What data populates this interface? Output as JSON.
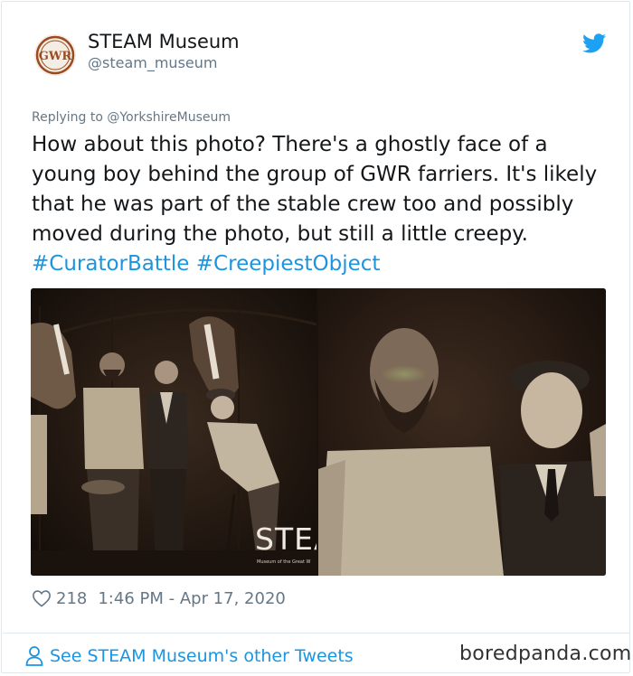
{
  "account": {
    "display_name": "STEAM Museum",
    "handle": "@steam_museum",
    "avatar_text": "GWR",
    "avatar_color": "#9c4a1f"
  },
  "tweet": {
    "reply_to": "Replying to @YorkshireMuseum",
    "text": "How about this photo? There's a ghostly face of a young boy behind the group of GWR farriers. It's likely that he was part of the stable crew too and possibly moved during the photo, but still a little creepy. ",
    "hashtags": [
      "#CuratorBattle",
      "#CreepiestObject"
    ],
    "media": {
      "left_photo_watermark": "STEA",
      "left_photo_watermark_sub": "Museum of the Great W"
    },
    "likes": "218",
    "timestamp": "1:46 PM - Apr 17, 2020"
  },
  "footer": {
    "other_tweets_link": "See STEAM Museum's other Tweets",
    "brand": "boredpanda.com"
  },
  "colors": {
    "link": "#1b95e0",
    "secondary_text": "#657786",
    "twitter_blue": "#1da1f2"
  },
  "icons": [
    "twitter-bird-icon",
    "heart-icon",
    "person-icon"
  ]
}
